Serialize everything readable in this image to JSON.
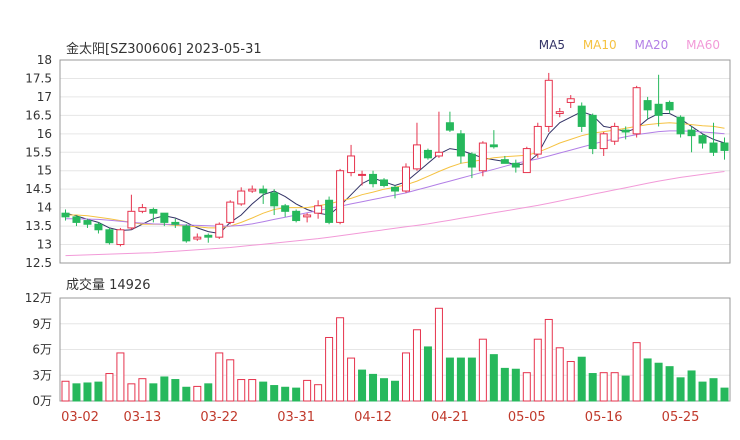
{
  "header": {
    "title": "金太阳[SZ300606] 2023-05-31",
    "volume_label": "成交量 14926"
  },
  "legend": [
    {
      "name": "MA5",
      "color": "#333366"
    },
    {
      "name": "MA10",
      "color": "#f5c242"
    },
    {
      "name": "MA20",
      "color": "#b27fe6"
    },
    {
      "name": "MA60",
      "color": "#f29ad8"
    }
  ],
  "colors": {
    "up": "#e6334d",
    "down": "#26b85c",
    "grid": "#e6e6e6",
    "border": "#999999",
    "date_text": "#c0392b"
  },
  "chart_data": [
    {
      "type": "candlestick",
      "title": "金太阳[SZ300606] 2023-05-31",
      "ylim": [
        12.5,
        18
      ],
      "yticks": [
        "18",
        "17.5",
        "17",
        "16.5",
        "16",
        "15.5",
        "15",
        "14.5",
        "14",
        "13.5",
        "13",
        "12.5"
      ],
      "xticks": [
        "03-02",
        "03-13",
        "03-22",
        "03-31",
        "04-12",
        "04-21",
        "05-05",
        "05-16",
        "05-25"
      ],
      "xtick_index": [
        0,
        7,
        14,
        21,
        28,
        35,
        42,
        49,
        56
      ],
      "candles": [
        [
          13.85,
          13.75,
          13.95,
          13.65
        ],
        [
          13.75,
          13.6,
          13.8,
          13.5
        ],
        [
          13.65,
          13.55,
          13.7,
          13.45
        ],
        [
          13.55,
          13.4,
          13.6,
          13.3
        ],
        [
          13.4,
          13.05,
          13.45,
          13.0
        ],
        [
          13.0,
          13.4,
          13.45,
          12.95
        ],
        [
          13.45,
          13.9,
          14.35,
          13.4
        ],
        [
          13.9,
          14.0,
          14.1,
          13.85
        ],
        [
          13.95,
          13.85,
          14.0,
          13.6
        ],
        [
          13.85,
          13.6,
          13.85,
          13.5
        ],
        [
          13.6,
          13.55,
          13.7,
          13.45
        ],
        [
          13.5,
          13.1,
          13.55,
          13.05
        ],
        [
          13.15,
          13.2,
          13.3,
          13.1
        ],
        [
          13.25,
          13.2,
          13.3,
          13.05
        ],
        [
          13.2,
          13.55,
          13.6,
          13.15
        ],
        [
          13.6,
          14.15,
          14.2,
          13.55
        ],
        [
          14.1,
          14.45,
          14.55,
          14.05
        ],
        [
          14.45,
          14.5,
          14.6,
          14.4
        ],
        [
          14.5,
          14.4,
          14.6,
          14.1
        ],
        [
          14.4,
          14.05,
          14.5,
          13.8
        ],
        [
          14.05,
          13.9,
          14.1,
          13.75
        ],
        [
          13.9,
          13.65,
          13.95,
          13.6
        ],
        [
          13.75,
          13.8,
          13.85,
          13.6
        ],
        [
          13.85,
          14.05,
          14.2,
          13.7
        ],
        [
          14.2,
          13.6,
          14.3,
          13.55
        ],
        [
          13.6,
          15.0,
          15.05,
          13.55
        ],
        [
          14.95,
          15.4,
          15.7,
          14.85
        ],
        [
          14.9,
          14.9,
          15.0,
          14.6
        ],
        [
          14.9,
          14.65,
          15.0,
          14.55
        ],
        [
          14.75,
          14.6,
          14.8,
          14.55
        ],
        [
          14.55,
          14.45,
          14.6,
          14.25
        ],
        [
          14.45,
          15.1,
          15.2,
          14.4
        ],
        [
          15.05,
          15.7,
          16.3,
          15.0
        ],
        [
          15.55,
          15.35,
          15.6,
          15.3
        ],
        [
          15.4,
          15.5,
          16.6,
          15.35
        ],
        [
          16.3,
          16.1,
          16.6,
          16.05
        ],
        [
          16.0,
          15.4,
          16.1,
          15.2
        ],
        [
          15.45,
          15.1,
          15.5,
          14.8
        ],
        [
          15.0,
          15.75,
          15.8,
          14.85
        ],
        [
          15.7,
          15.65,
          16.1,
          15.6
        ],
        [
          15.3,
          15.2,
          15.4,
          15.2
        ],
        [
          15.2,
          15.1,
          15.3,
          14.95
        ],
        [
          14.95,
          15.6,
          15.65,
          14.95
        ],
        [
          15.45,
          16.2,
          16.3,
          15.35
        ],
        [
          16.2,
          17.45,
          17.65,
          16.05
        ],
        [
          16.55,
          16.6,
          16.7,
          16.45
        ],
        [
          16.85,
          16.95,
          17.05,
          16.7
        ],
        [
          16.75,
          16.2,
          16.85,
          16.05
        ],
        [
          16.5,
          15.6,
          16.55,
          15.45
        ],
        [
          15.6,
          16.0,
          16.05,
          15.4
        ],
        [
          15.8,
          16.2,
          16.3,
          15.7
        ],
        [
          16.1,
          16.05,
          16.2,
          15.85
        ],
        [
          16.0,
          17.25,
          17.3,
          15.9
        ],
        [
          16.9,
          16.65,
          17.0,
          16.4
        ],
        [
          16.8,
          16.5,
          17.6,
          16.2
        ],
        [
          16.85,
          16.65,
          16.9,
          16.55
        ],
        [
          16.45,
          16.0,
          16.5,
          15.9
        ],
        [
          16.1,
          15.95,
          16.2,
          15.5
        ],
        [
          15.95,
          15.75,
          16.0,
          15.6
        ],
        [
          15.75,
          15.5,
          16.3,
          15.4
        ],
        [
          15.75,
          15.55,
          15.9,
          15.3
        ]
      ],
      "ma": {
        "MA5": [
          13.85,
          13.78,
          13.68,
          13.6,
          13.45,
          13.38,
          13.4,
          13.55,
          13.7,
          13.78,
          13.72,
          13.6,
          13.45,
          13.35,
          13.3,
          13.6,
          13.8,
          14.1,
          14.35,
          14.45,
          14.3,
          14.1,
          13.95,
          13.85,
          13.8,
          14.05,
          14.35,
          14.65,
          14.8,
          14.7,
          14.6,
          14.7,
          14.95,
          15.2,
          15.45,
          15.6,
          15.55,
          15.45,
          15.35,
          15.3,
          15.25,
          15.15,
          15.2,
          15.45,
          16.0,
          16.3,
          16.45,
          16.6,
          16.5,
          16.2,
          16.15,
          16.05,
          16.15,
          16.4,
          16.55,
          16.55,
          16.4,
          16.2,
          16.0,
          15.85,
          15.75
        ],
        "MA10": [
          13.8,
          13.8,
          13.78,
          13.74,
          13.7,
          13.65,
          13.6,
          13.55,
          13.55,
          13.55,
          13.52,
          13.5,
          13.48,
          13.45,
          13.45,
          13.5,
          13.6,
          13.72,
          13.85,
          13.95,
          14.0,
          14.0,
          14.0,
          14.05,
          14.1,
          14.18,
          14.25,
          14.35,
          14.42,
          14.5,
          14.55,
          14.62,
          14.72,
          14.85,
          14.98,
          15.1,
          15.2,
          15.25,
          15.3,
          15.35,
          15.38,
          15.4,
          15.42,
          15.5,
          15.62,
          15.75,
          15.85,
          15.95,
          16.02,
          16.06,
          16.1,
          16.15,
          16.2,
          16.25,
          16.28,
          16.3,
          16.28,
          16.25,
          16.22,
          16.2,
          16.15
        ],
        "MA20": [
          13.7,
          13.7,
          13.69,
          13.68,
          13.66,
          13.63,
          13.6,
          13.58,
          13.56,
          13.55,
          13.54,
          13.53,
          13.52,
          13.51,
          13.5,
          13.5,
          13.52,
          13.56,
          13.62,
          13.68,
          13.74,
          13.8,
          13.86,
          13.92,
          13.98,
          14.04,
          14.1,
          14.16,
          14.22,
          14.28,
          14.34,
          14.4,
          14.48,
          14.56,
          14.64,
          14.72,
          14.8,
          14.88,
          14.96,
          15.04,
          15.12,
          15.2,
          15.26,
          15.32,
          15.4,
          15.48,
          15.56,
          15.64,
          15.72,
          15.8,
          15.86,
          15.92,
          15.98,
          16.02,
          16.06,
          16.08,
          16.08,
          16.07,
          16.05,
          16.03,
          16.0
        ],
        "MA60": [
          12.7,
          12.71,
          12.72,
          12.73,
          12.74,
          12.75,
          12.76,
          12.77,
          12.78,
          12.8,
          12.82,
          12.84,
          12.86,
          12.88,
          12.9,
          12.92,
          12.95,
          12.98,
          13.01,
          13.04,
          13.07,
          13.1,
          13.13,
          13.16,
          13.2,
          13.24,
          13.28,
          13.32,
          13.36,
          13.4,
          13.44,
          13.48,
          13.52,
          13.56,
          13.61,
          13.66,
          13.71,
          13.76,
          13.81,
          13.86,
          13.91,
          13.96,
          14.01,
          14.06,
          14.12,
          14.18,
          14.24,
          14.3,
          14.36,
          14.42,
          14.48,
          14.54,
          14.6,
          14.66,
          14.72,
          14.77,
          14.82,
          14.86,
          14.9,
          14.94,
          14.98
        ]
      }
    },
    {
      "type": "bar",
      "title": "成交量 14926",
      "ylim": [
        0,
        12
      ],
      "yticks": [
        "12万",
        "9万",
        "6万",
        "3万",
        "0万"
      ],
      "values": [
        2.3,
        2.0,
        2.1,
        2.2,
        3.2,
        5.6,
        2.0,
        2.6,
        2.0,
        2.8,
        2.5,
        1.6,
        1.7,
        2.0,
        5.6,
        4.8,
        2.5,
        2.5,
        2.2,
        1.8,
        1.6,
        1.5,
        2.4,
        1.9,
        7.4,
        9.7,
        5.0,
        3.6,
        3.1,
        2.6,
        2.3,
        5.6,
        8.3,
        6.3,
        10.8,
        5.0,
        5.0,
        5.0,
        7.2,
        5.4,
        3.8,
        3.7,
        3.3,
        7.2,
        9.5,
        6.2,
        4.6,
        5.1,
        3.2,
        3.3,
        3.3,
        2.9,
        6.8,
        4.9,
        4.4,
        4.0,
        2.7,
        3.5,
        2.2,
        2.6,
        1.5
      ],
      "up": [
        true,
        false,
        false,
        false,
        true,
        true,
        true,
        true,
        false,
        false,
        false,
        false,
        true,
        false,
        true,
        true,
        true,
        true,
        false,
        false,
        false,
        false,
        true,
        true,
        true,
        true,
        true,
        false,
        false,
        false,
        false,
        true,
        true,
        false,
        true,
        false,
        false,
        false,
        true,
        false,
        false,
        false,
        true,
        true,
        true,
        true,
        true,
        false,
        false,
        true,
        true,
        false,
        true,
        false,
        false,
        false,
        false,
        false,
        false,
        false,
        false
      ]
    }
  ]
}
